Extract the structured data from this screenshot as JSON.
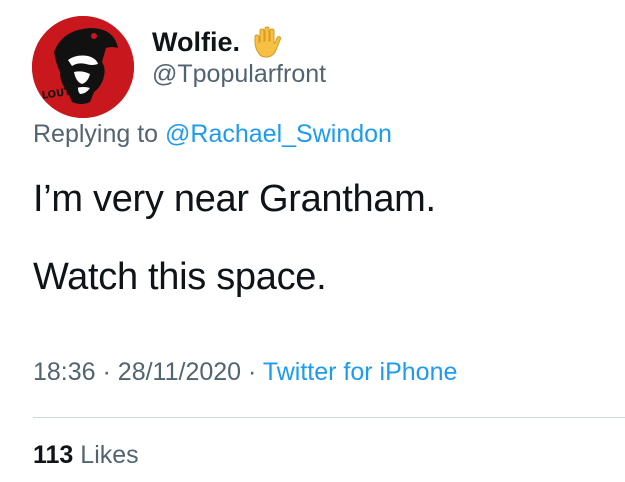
{
  "user": {
    "display_name": "Wolfie.",
    "handle": "@Tpopularfront",
    "emoji_icon": "raised-hand-icon",
    "avatar_text": "LOUTH",
    "avatar_bg": "#c8171d"
  },
  "reply": {
    "prefix": "Replying to",
    "mention": "@Rachael_Swindon"
  },
  "tweet": {
    "line1": "I’m very near Grantham.",
    "line2": "Watch this space."
  },
  "meta": {
    "time": "18:36",
    "sep1": "·",
    "date": "28/11/2020",
    "sep2": "·",
    "source": "Twitter for iPhone"
  },
  "stats": {
    "likes_count": "113",
    "likes_label": "Likes"
  },
  "colors": {
    "link": "#1d9bf0",
    "secondary_text": "#536471",
    "primary_text": "#0f1419",
    "divider": "#cfd9de"
  }
}
